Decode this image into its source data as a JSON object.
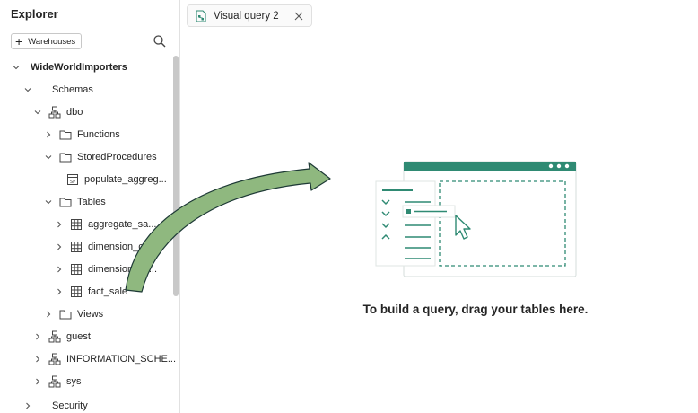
{
  "explorer": {
    "title": "Explorer",
    "warehouses_button": "Warehouses",
    "tree": {
      "database": "WideWorldImporters",
      "schemas": "Schemas",
      "dbo": "dbo",
      "functions": "Functions",
      "stored_procedures": "StoredProcedures",
      "proc_item": "populate_aggreg...",
      "tables": "Tables",
      "table_items": [
        "aggregate_sa...",
        "dimension_cit...",
        "dimension_cu...",
        "fact_sale"
      ],
      "views": "Views",
      "guest": "guest",
      "information_schema": "INFORMATION_SCHE...",
      "sys": "sys",
      "security": "Security"
    }
  },
  "tabs": [
    {
      "label": "Visual query 2"
    }
  ],
  "canvas": {
    "empty_message": "To build a query, drag your tables here."
  },
  "colors": {
    "accent": "#2f8a73",
    "arrow_fill": "#8fb87f",
    "arrow_stroke": "#1e3a36"
  }
}
